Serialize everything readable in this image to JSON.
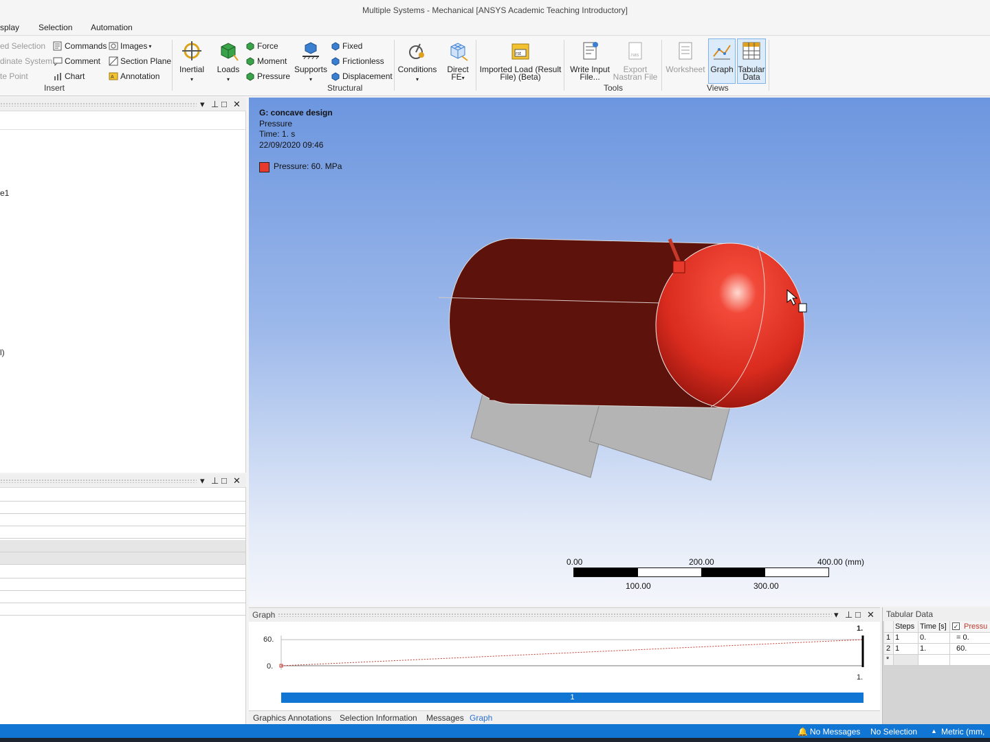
{
  "window": {
    "title": "Multiple Systems - Mechanical [ANSYS Academic Teaching Introductory]"
  },
  "menu": {
    "tabs": [
      "splay",
      "Selection",
      "Automation"
    ]
  },
  "ribbon": {
    "insert": {
      "items_left": [
        "ed Selection",
        "dinate System",
        "te Point"
      ],
      "items_mid": [
        "Commands",
        "Comment",
        "Chart"
      ],
      "items_right": [
        "Images",
        "Section Plane",
        "Annotation"
      ],
      "group_label": "Insert"
    },
    "structural": {
      "inertial": "Inertial",
      "loads": "Loads",
      "loads_items": [
        "Force",
        "Moment",
        "Pressure"
      ],
      "supports": "Supports",
      "supports_items": [
        "Fixed",
        "Frictionless",
        "Displacement"
      ],
      "conditions": "Conditions",
      "direct_fe_1": "Direct",
      "direct_fe_2": "FE",
      "group_label": "Structural"
    },
    "imported_load": {
      "line1": "Imported Load (Result",
      "line2": "File) (Beta)"
    },
    "tools": {
      "write_input_1": "Write Input",
      "write_input_2": "File...",
      "export_nastran_1": "Export",
      "export_nastran_2": "Nastran File",
      "group_label": "Tools"
    },
    "views": {
      "worksheet": "Worksheet",
      "graph": "Graph",
      "tabular_1": "Tabular",
      "tabular_2": "Data",
      "group_label": "Views"
    }
  },
  "outline": {
    "fragments": [
      "e1",
      "l)"
    ]
  },
  "viewport": {
    "title": "G: concave design",
    "subtitle": "Pressure",
    "time": "Time: 1. s",
    "date": "22/09/2020 09:46",
    "legend": "Pressure: 60. MPa",
    "legend_color": "#e83a2c",
    "scale": {
      "top_labels": [
        "0.00",
        "200.00",
        "400.00 (mm)"
      ],
      "bottom_labels": [
        "100.00",
        "300.00"
      ]
    }
  },
  "graph": {
    "title": "Graph",
    "y_labels": [
      "60.",
      "0."
    ],
    "x_top_label": "1.",
    "x_bottom_label": "1.",
    "step_bar_label": "1",
    "line_color": "#c0392b",
    "step_color": "#1175d3"
  },
  "bottom_tabs": [
    "Graphics Annotations",
    "Selection Information",
    "Messages",
    "Graph"
  ],
  "tabular": {
    "title": "Tabular Data",
    "headers": [
      "Steps",
      "Time [s]",
      "Pressu"
    ],
    "rows": [
      {
        "index": "1",
        "steps": "1",
        "time": "0.",
        "value": "= 0."
      },
      {
        "index": "2",
        "steps": "1",
        "time": "1.",
        "value": "60."
      },
      {
        "index": "*",
        "steps": "",
        "time": "",
        "value": ""
      }
    ]
  },
  "status": {
    "messages": "No Messages",
    "selection": "No Selection",
    "units": "Metric (mm,"
  }
}
